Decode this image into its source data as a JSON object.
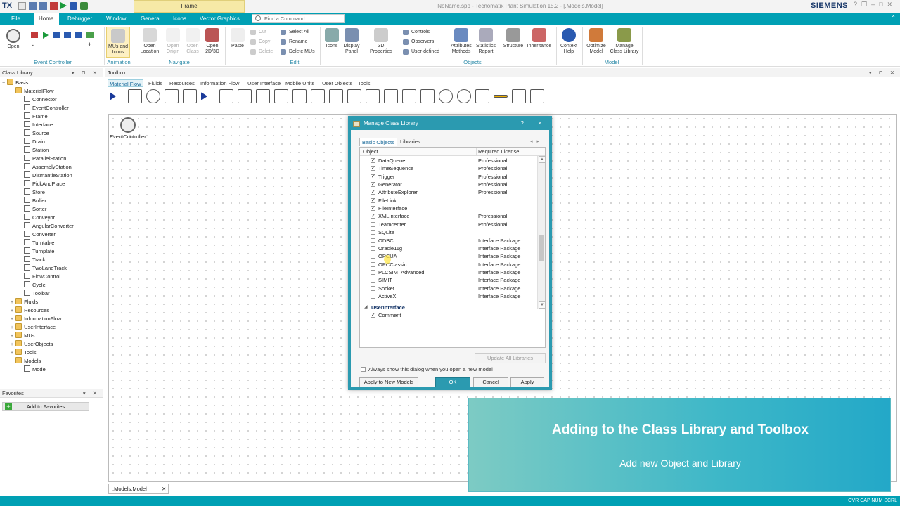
{
  "titlebar": {
    "logo": "TX",
    "frame_tab": "Frame",
    "window_title": "NoName.spp - Tecnomatix Plant Simulation 15.2 - [.Models.Model]",
    "brand": "SIEMENS"
  },
  "menu_tabs": [
    "File",
    "Home",
    "Debugger",
    "Window",
    "General",
    "Icons",
    "Vector Graphics"
  ],
  "find_command": "Find a Command",
  "ribbon": {
    "open": "Open",
    "event_controller_group": "Event Controller",
    "mus_icons_1": "MUs and",
    "mus_icons_2": "Icons",
    "animation_group": "Animation",
    "open_location_1": "Open",
    "open_location_2": "Location",
    "open_origin_1": "Open",
    "open_origin_2": "Origin",
    "open_class_1": "Open",
    "open_class_2": "Class",
    "open_2d3d_1": "Open",
    "open_2d3d_2": "2D/3D",
    "navigate_group": "Navigate",
    "paste": "Paste",
    "cut": "Cut",
    "copy": "Copy",
    "delete": "Delete",
    "select_all": "Select All",
    "rename": "Rename",
    "delete_mus": "Delete MUs",
    "edit_group": "Edit",
    "icons": "Icons",
    "display_panel_1": "Display",
    "display_panel_2": "Panel",
    "properties_3d_1": "3D",
    "properties_3d_2": "Properties",
    "controls": "Controls",
    "observers": "Observers",
    "user_defined": "User-defined",
    "attributes_methods_1": "Attributes",
    "attributes_methods_2": "Methods",
    "statistics_report_1": "Statistics",
    "statistics_report_2": "Report",
    "structure": "Structure",
    "inheritance": "Inheritance",
    "objects_group": "Objects",
    "context_help_1": "Context",
    "context_help_2": "Help",
    "optimize_model_1": "Optimize",
    "optimize_model_2": "Model",
    "manage_class_library_1": "Manage",
    "manage_class_library_2": "Class Library",
    "model_group": "Model"
  },
  "class_library": {
    "title": "Class Library",
    "items": [
      {
        "label": "Basis",
        "level": 0,
        "kind": "root"
      },
      {
        "label": "MaterialFlow",
        "level": 1,
        "kind": "folder"
      },
      {
        "label": "Connector",
        "level": 2,
        "kind": "obj"
      },
      {
        "label": "EventController",
        "level": 2,
        "kind": "obj"
      },
      {
        "label": "Frame",
        "level": 2,
        "kind": "obj"
      },
      {
        "label": "Interface",
        "level": 2,
        "kind": "obj"
      },
      {
        "label": "Source",
        "level": 2,
        "kind": "obj"
      },
      {
        "label": "Drain",
        "level": 2,
        "kind": "obj"
      },
      {
        "label": "Station",
        "level": 2,
        "kind": "obj"
      },
      {
        "label": "ParallelStation",
        "level": 2,
        "kind": "obj"
      },
      {
        "label": "AssemblyStation",
        "level": 2,
        "kind": "obj"
      },
      {
        "label": "DismantleStation",
        "level": 2,
        "kind": "obj"
      },
      {
        "label": "PickAndPlace",
        "level": 2,
        "kind": "obj"
      },
      {
        "label": "Store",
        "level": 2,
        "kind": "obj"
      },
      {
        "label": "Buffer",
        "level": 2,
        "kind": "obj"
      },
      {
        "label": "Sorter",
        "level": 2,
        "kind": "obj"
      },
      {
        "label": "Conveyor",
        "level": 2,
        "kind": "obj"
      },
      {
        "label": "AngularConverter",
        "level": 2,
        "kind": "obj"
      },
      {
        "label": "Converter",
        "level": 2,
        "kind": "obj"
      },
      {
        "label": "Turntable",
        "level": 2,
        "kind": "obj"
      },
      {
        "label": "Turnplate",
        "level": 2,
        "kind": "obj"
      },
      {
        "label": "Track",
        "level": 2,
        "kind": "obj"
      },
      {
        "label": "TwoLaneTrack",
        "level": 2,
        "kind": "obj"
      },
      {
        "label": "FlowControl",
        "level": 2,
        "kind": "obj"
      },
      {
        "label": "Cycle",
        "level": 2,
        "kind": "obj"
      },
      {
        "label": "Toolbar",
        "level": 2,
        "kind": "obj"
      },
      {
        "label": "Fluids",
        "level": 1,
        "kind": "folder"
      },
      {
        "label": "Resources",
        "level": 1,
        "kind": "folder"
      },
      {
        "label": "InformationFlow",
        "level": 1,
        "kind": "folder"
      },
      {
        "label": "UserInterface",
        "level": 1,
        "kind": "folder"
      },
      {
        "label": "MUs",
        "level": 1,
        "kind": "folder"
      },
      {
        "label": "UserObjects",
        "level": 1,
        "kind": "folder"
      },
      {
        "label": "Tools",
        "level": 1,
        "kind": "folder"
      },
      {
        "label": "Models",
        "level": 1,
        "kind": "folder"
      },
      {
        "label": "Model",
        "level": 2,
        "kind": "obj"
      }
    ]
  },
  "favorites": {
    "title": "Favorites",
    "add_button": "Add to Favorites"
  },
  "toolbox": {
    "title": "Toolbox",
    "tabs": [
      "Material Flow",
      "Fluids",
      "Resources",
      "Information Flow",
      "User Interface",
      "Mobile Units",
      "User Objects",
      "Tools"
    ]
  },
  "frame": {
    "event_controller_label": "EventController",
    "doc_tab": ".Models.Model"
  },
  "status_bar": "OVR  CAP  NUM  SCRL",
  "dialog": {
    "title": "Manage Class Library",
    "help": "?",
    "close": "×",
    "tabs": [
      "Basic Objects",
      "Libraries"
    ],
    "col_object": "Object",
    "col_license": "Required License",
    "rows": [
      {
        "name": "DataQueue",
        "checked": true,
        "license": "Professional"
      },
      {
        "name": "TimeSequence",
        "checked": true,
        "license": "Professional"
      },
      {
        "name": "Trigger",
        "checked": true,
        "license": "Professional"
      },
      {
        "name": "Generator",
        "checked": true,
        "license": "Professional"
      },
      {
        "name": "AttributeExplorer",
        "checked": true,
        "license": "Professional"
      },
      {
        "name": "FileLink",
        "checked": true,
        "license": ""
      },
      {
        "name": "FileInterface",
        "checked": true,
        "license": ""
      },
      {
        "name": "XMLInterface",
        "checked": true,
        "license": "Professional"
      },
      {
        "name": "Teamcenter",
        "checked": false,
        "license": "Professional"
      },
      {
        "name": "SQLite",
        "checked": false,
        "license": ""
      },
      {
        "name": "ODBC",
        "checked": false,
        "license": "Interface Package"
      },
      {
        "name": "Oracle11g",
        "checked": false,
        "license": "Interface Package"
      },
      {
        "name": "OPCUA",
        "checked": false,
        "license": "Interface Package"
      },
      {
        "name": "OPCClassic",
        "checked": false,
        "license": "Interface Package"
      },
      {
        "name": "PLCSIM_Advanced",
        "checked": false,
        "license": "Interface Package"
      },
      {
        "name": "SIMIT",
        "checked": false,
        "license": "Interface Package"
      },
      {
        "name": "Socket",
        "checked": false,
        "license": "Interface Package"
      },
      {
        "name": "ActiveX",
        "checked": false,
        "license": "Interface Package"
      }
    ],
    "group_label": "UserInterface",
    "partial_row": "Comment",
    "update_all": "Update All Libraries",
    "show_dialog": "Always show this dialog when you open a new model",
    "apply_new": "Apply to New Models",
    "ok": "OK",
    "cancel": "Cancel",
    "apply": "Apply"
  },
  "banner": {
    "title": "Adding to the Class Library and Toolbox",
    "subtitle": "Add new Object and Library"
  },
  "colors": {
    "accent": "#00a0b4",
    "dialog_border": "#2b9ab0",
    "banner_start": "#7dcbc4",
    "banner_end": "#23a8c8"
  }
}
